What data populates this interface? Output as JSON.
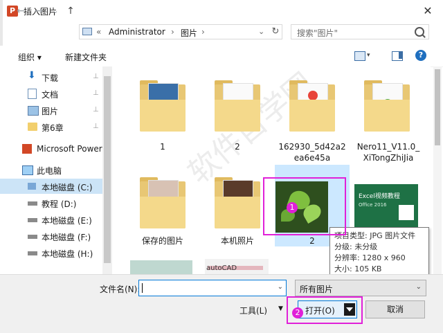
{
  "window": {
    "title": "插入图片",
    "app_icon_letter": "P",
    "close_glyph": "✕"
  },
  "nav": {
    "back": "←",
    "forward": "→",
    "recent": "⌄",
    "up": "↑"
  },
  "address": {
    "overflow": "«",
    "segments": [
      "Administrator",
      "图片"
    ],
    "separator": "›",
    "dropdown": "⌄",
    "refresh": "↻"
  },
  "search": {
    "placeholder": "搜索\"图片\""
  },
  "toolbar": {
    "organize": "组织 ▾",
    "new_folder": "新建文件夹"
  },
  "sidebar": {
    "items": [
      {
        "label": "下载",
        "pinned": true
      },
      {
        "label": "文档",
        "pinned": true
      },
      {
        "label": "图片",
        "pinned": true
      },
      {
        "label": "第6章",
        "pinned": true
      },
      {
        "label": "Microsoft Power"
      },
      {
        "label": "此电脑"
      },
      {
        "label": "本地磁盘 (C:)",
        "selected": true
      },
      {
        "label": "教程 (D:)"
      },
      {
        "label": "本地磁盘 (E:)"
      },
      {
        "label": "本地磁盘 (F:)"
      },
      {
        "label": "本地磁盘 (H:)"
      }
    ],
    "pin_glyph": "📌"
  },
  "files": [
    {
      "name": "1",
      "type": "folder"
    },
    {
      "name": "2",
      "type": "folder"
    },
    {
      "name": "162930_5d42a2ea6e45a",
      "name_line1": "162930_5d42a2",
      "name_line2": "ea6e45a",
      "type": "folder"
    },
    {
      "name": "Nero11_V11.0_XiTongZhiJia",
      "name_line1": "Nero11_V11.0_",
      "name_line2": "XiTongZhiJia",
      "type": "folder"
    },
    {
      "name": "保存的图片",
      "type": "folder"
    },
    {
      "name": "本机照片",
      "type": "folder"
    },
    {
      "name": "2",
      "type": "image",
      "selected": true
    },
    {
      "name": "",
      "type": "image",
      "thumb_title": "Excel视频教程",
      "thumb_sub": "Office 2016"
    }
  ],
  "partial_row": {
    "autocad_text": "autoCAD"
  },
  "tooltip": {
    "lines": [
      "项目类型: JPG 图片文件",
      "分级: 未分级",
      "分辨率: 1280 x 960",
      "大小: 105 KB"
    ]
  },
  "bottom": {
    "filename_label": "文件名(N):",
    "filename_value": "",
    "filter_value": "所有图片",
    "tools_label": "工具(L)",
    "open_label": "打开(O)",
    "cancel_label": "取消"
  },
  "annotations": {
    "badge1": "1",
    "badge2": "2",
    "highlight_color": "#e020d8"
  },
  "watermark": "软件自学网"
}
